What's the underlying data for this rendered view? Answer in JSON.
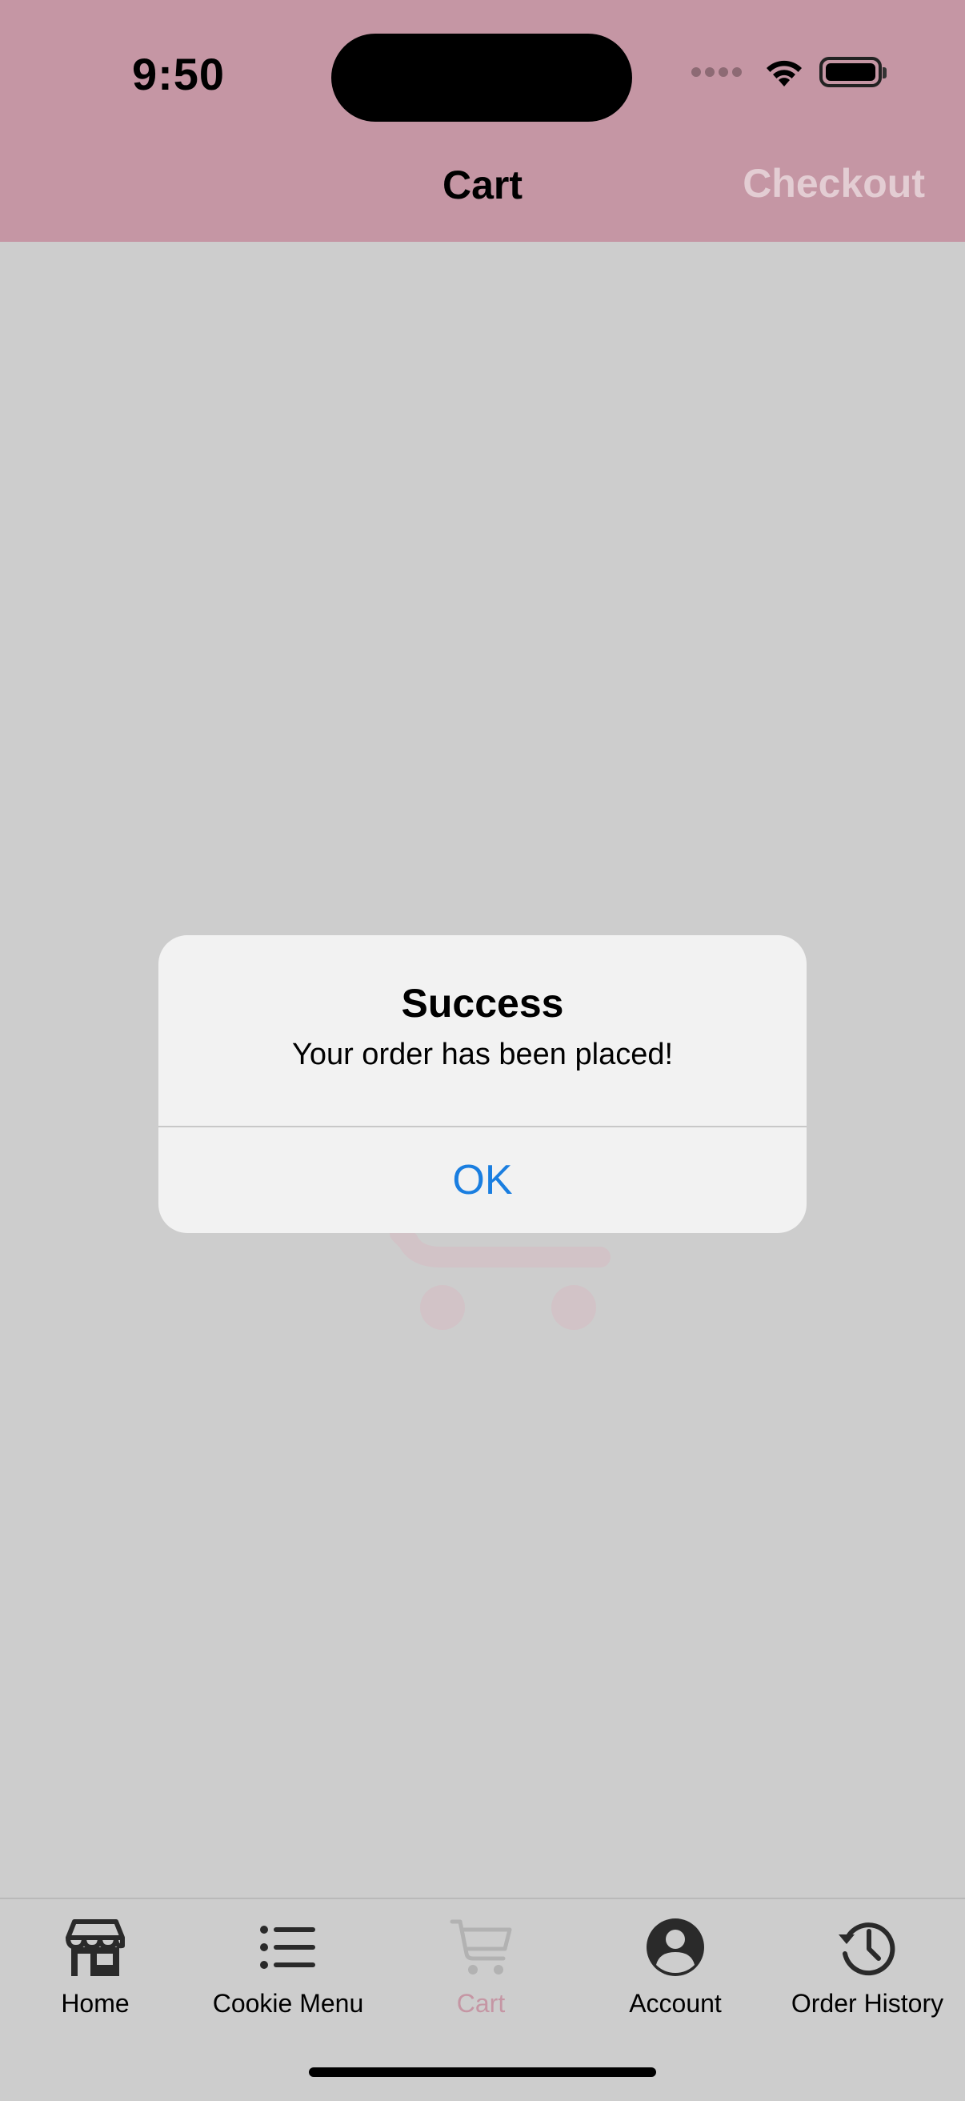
{
  "status_bar": {
    "time": "9:50"
  },
  "nav": {
    "title": "Cart",
    "checkout_label": "Checkout"
  },
  "alert": {
    "title": "Success",
    "message": "Your order has been placed!",
    "ok_label": "OK"
  },
  "tabs": [
    {
      "label": "Home",
      "icon": "storefront-icon"
    },
    {
      "label": "Cookie Menu",
      "icon": "list-icon"
    },
    {
      "label": "Cart",
      "icon": "cart-icon",
      "active": true
    },
    {
      "label": "Account",
      "icon": "account-circle-icon"
    },
    {
      "label": "Order History",
      "icon": "history-icon"
    }
  ],
  "colors": {
    "header_tint": "#c596a4",
    "accent": "#c596a4",
    "alert_button": "#1a7ee0",
    "background": "#cdcdcd"
  }
}
